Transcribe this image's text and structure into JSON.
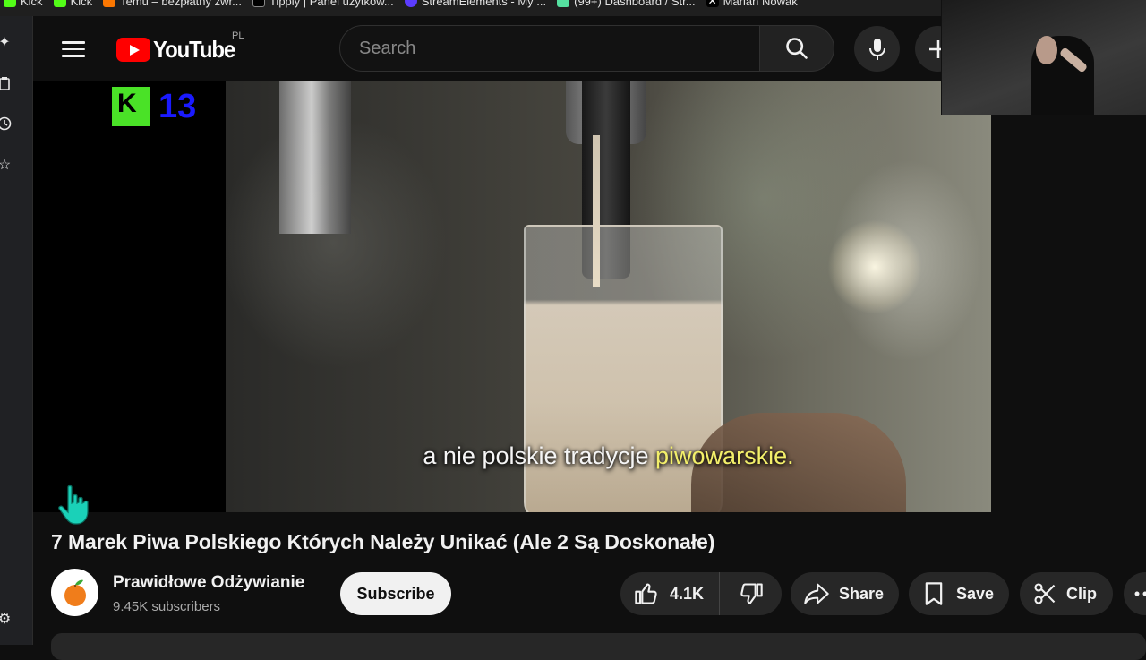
{
  "bookmarks": [
    {
      "label": "Kick",
      "icon": "kick-icon",
      "color": "#53fc18"
    },
    {
      "label": "Kick",
      "icon": "kick-icon",
      "color": "#53fc18"
    },
    {
      "label": "Temu – bezpłatny zwr...",
      "icon": "temu-icon",
      "color": "#fb7701"
    },
    {
      "label": "Tipply | Panel użytkow...",
      "icon": "tipply-icon",
      "color": "#000000"
    },
    {
      "label": "StreamElements - My ...",
      "icon": "streamelements-icon",
      "color": "#5c3cff"
    },
    {
      "label": "(99+) Dashboard / Str...",
      "icon": "dashboard-icon",
      "color": "#55e0a0"
    },
    {
      "label": "Marian Nowak",
      "icon": "x-icon",
      "color": "#000000"
    }
  ],
  "masthead": {
    "logo_text": "YouTube",
    "country": "PL",
    "search_placeholder": "Search"
  },
  "overlay": {
    "k_letter": "K",
    "number": "13"
  },
  "video": {
    "subtitle_plain": "a nie polskie tradycje ",
    "subtitle_highlight": "piwowarskie.",
    "highlight_color": "#f3ef6a"
  },
  "details": {
    "title": "7 Marek Piwa Polskiego Których Należy Unikać (Ale 2 Są Doskonałe)",
    "channel_name": "Prawidłowe Odżywianie",
    "subscribers": "9.45K subscribers",
    "subscribe_label": "Subscribe",
    "like_count": "4.1K",
    "share_label": "Share",
    "save_label": "Save",
    "clip_label": "Clip"
  },
  "colors": {
    "brand_red": "#ff0000",
    "background": "#0f0f0f",
    "pill": "#272727"
  }
}
